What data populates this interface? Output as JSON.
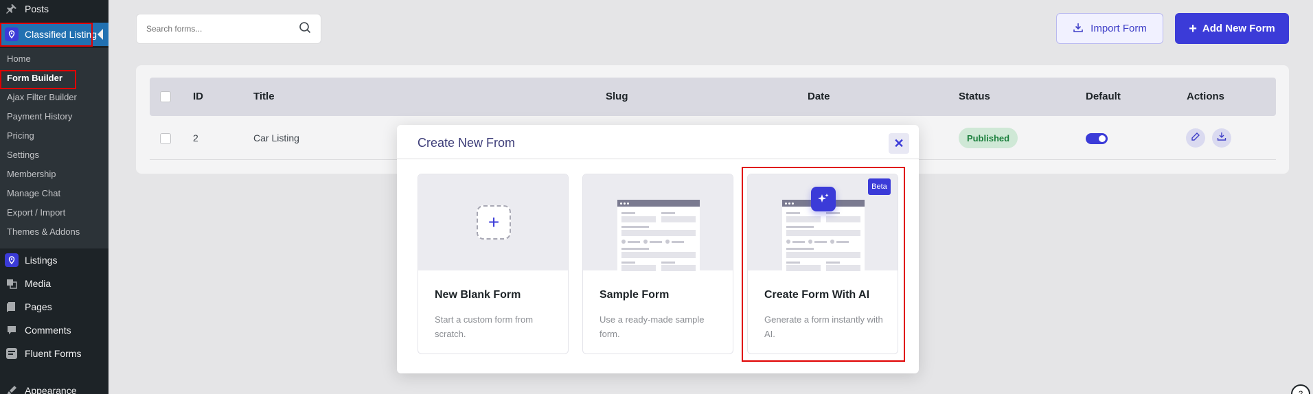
{
  "sidebar": {
    "items_top": [
      {
        "label": "Posts",
        "icon": "pushpin-icon"
      },
      {
        "label": "Classified Listing",
        "icon": "map-pin-icon"
      }
    ],
    "submenu": [
      {
        "label": "Home"
      },
      {
        "label": "Form Builder"
      },
      {
        "label": "Ajax Filter Builder"
      },
      {
        "label": "Payment History"
      },
      {
        "label": "Pricing"
      },
      {
        "label": "Settings"
      },
      {
        "label": "Membership"
      },
      {
        "label": "Manage Chat"
      },
      {
        "label": "Export / Import"
      },
      {
        "label": "Themes & Addons"
      }
    ],
    "items_bottom": [
      {
        "label": "Listings",
        "icon": "map-pin-icon"
      },
      {
        "label": "Media",
        "icon": "media-icon"
      },
      {
        "label": "Pages",
        "icon": "pages-icon"
      },
      {
        "label": "Comments",
        "icon": "comment-icon"
      },
      {
        "label": "Fluent Forms",
        "icon": "forms-icon"
      },
      {
        "label": "Appearance",
        "icon": "brush-icon"
      }
    ]
  },
  "toolbar": {
    "search_placeholder": "Search forms...",
    "import_label": "Import Form",
    "add_label": "Add New Form"
  },
  "table": {
    "headers": [
      "ID",
      "Title",
      "Slug",
      "Date",
      "Status",
      "Default",
      "Actions"
    ],
    "rows": [
      {
        "id": "2",
        "title": "Car Listing",
        "status": "Published",
        "default": true
      }
    ]
  },
  "modal": {
    "title": "Create New From",
    "options": [
      {
        "title": "New Blank Form",
        "desc": "Start a custom form from scratch."
      },
      {
        "title": "Sample Form",
        "desc": "Use a ready-made sample form."
      },
      {
        "title": "Create Form With AI",
        "desc": "Generate a form instantly with AI.",
        "badge": "Beta"
      }
    ]
  },
  "colors": {
    "accent": "#3b3bd8",
    "wp_sidebar": "#1d2327",
    "wp_active": "#2271b1",
    "highlight": "#e00000"
  },
  "help": {
    "label": "?"
  }
}
